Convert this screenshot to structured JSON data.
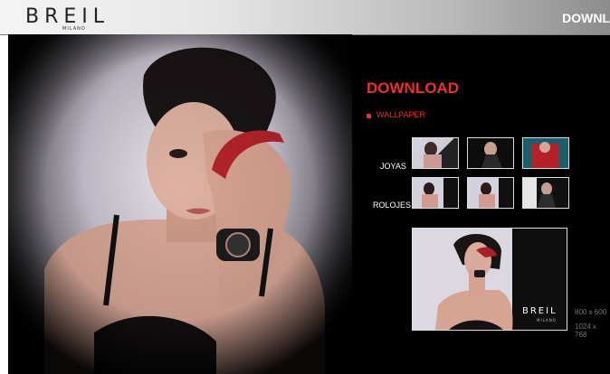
{
  "header": {
    "logo_text": "BREIL",
    "logo_sub": "MILANO",
    "nav_link": "DOWNL"
  },
  "download": {
    "title": "DOWNLOAD",
    "section": "WALLPAPER",
    "rows": [
      {
        "label": "JOYAS",
        "thumbs": [
          "joyas-1",
          "joyas-2",
          "joyas-3"
        ]
      },
      {
        "label": "ROLOJES",
        "thumbs": [
          "rolojes-1",
          "rolojes-2",
          "rolojes-3"
        ]
      }
    ],
    "preview_logo": "BREIL",
    "preview_logo_sub": "MILANO",
    "resolutions": [
      "800 x 600",
      "1024 x 768"
    ]
  },
  "colors": {
    "accent": "#e8322a",
    "background": "#000000"
  }
}
